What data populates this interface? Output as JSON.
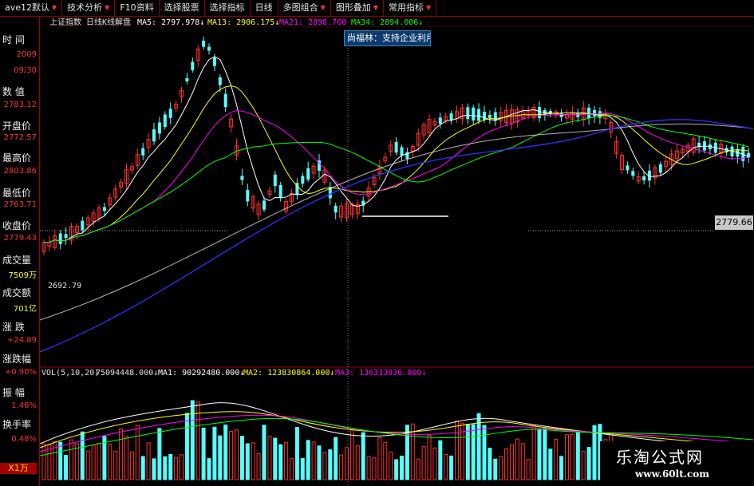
{
  "menu": [
    {
      "label": "ave12默认",
      "arrow": "▼"
    },
    {
      "label": "技术分析",
      "arrow": "▼"
    },
    {
      "label": "F10资料",
      "arrow": ""
    },
    {
      "label": "选择股票",
      "arrow": ""
    },
    {
      "label": "选择指标",
      "arrow": ""
    },
    {
      "label": "日线",
      "arrow": ""
    },
    {
      "label": "多图组合",
      "arrow": "▼"
    },
    {
      "label": "图形叠加",
      "arrow": "▼"
    },
    {
      "label": "常用指标",
      "arrow": "▼"
    }
  ],
  "left_panel": {
    "time_label": "时 间",
    "time_year": "2009",
    "time_date": "09/30",
    "value_label": "数 值",
    "value": "2783.12",
    "open_label": "开盘价",
    "open": "2772.57",
    "high_label": "最高价",
    "high": "2803.86",
    "low_label": "最低价",
    "low": "2763.71",
    "close_label": "收盘价",
    "close": "2779.43",
    "volume_label": "成交量",
    "volume": "7509万",
    "amount_label": "成交额",
    "amount": "701亿",
    "change_label": "涨 跌",
    "change": "+24.89",
    "pct_label": "涨跌幅",
    "pct": "+0.90%",
    "amp_label": "振 幅",
    "amp": "1.46%",
    "turnover_label": "换手率",
    "turnover": "0.48%",
    "corner": "X1万"
  },
  "price_panel": {
    "symbol": "上证指数",
    "period": "日线",
    "indicator": "K线解盘",
    "ma5_label": "MA5:",
    "ma5": "2797.978",
    "ma13_label": "MA13:",
    "ma13": "2906.175",
    "ma21_label": "MA21:",
    "ma21": "2898.760",
    "ma34_label": "MA34:",
    "ma34": "2894.006",
    "low_point_label": "2692.79",
    "cursor_price": "2779.66",
    "info_popup": "尚福林：支持企业利用"
  },
  "volume_panel": {
    "label": "VOL(5,10,20)",
    "vol": "75094448.000",
    "ma1_label": "MA1:",
    "ma1": "90292480.000",
    "ma2_label": "MA2:",
    "ma2": "123830864.000",
    "ma3_label": "MA3:",
    "ma3": "136333936.000"
  },
  "watermark": {
    "title": "乐淘公式网",
    "url": "www.60lt.com"
  },
  "colors": {
    "up": "#ff3030",
    "down": "#54ffff",
    "ma5": "#ffffff",
    "ma13": "#ffff00",
    "ma21": "#ff00ff",
    "ma34": "#00ff00",
    "ma_long": "#3030ff",
    "grid_red": "#a00000"
  }
}
